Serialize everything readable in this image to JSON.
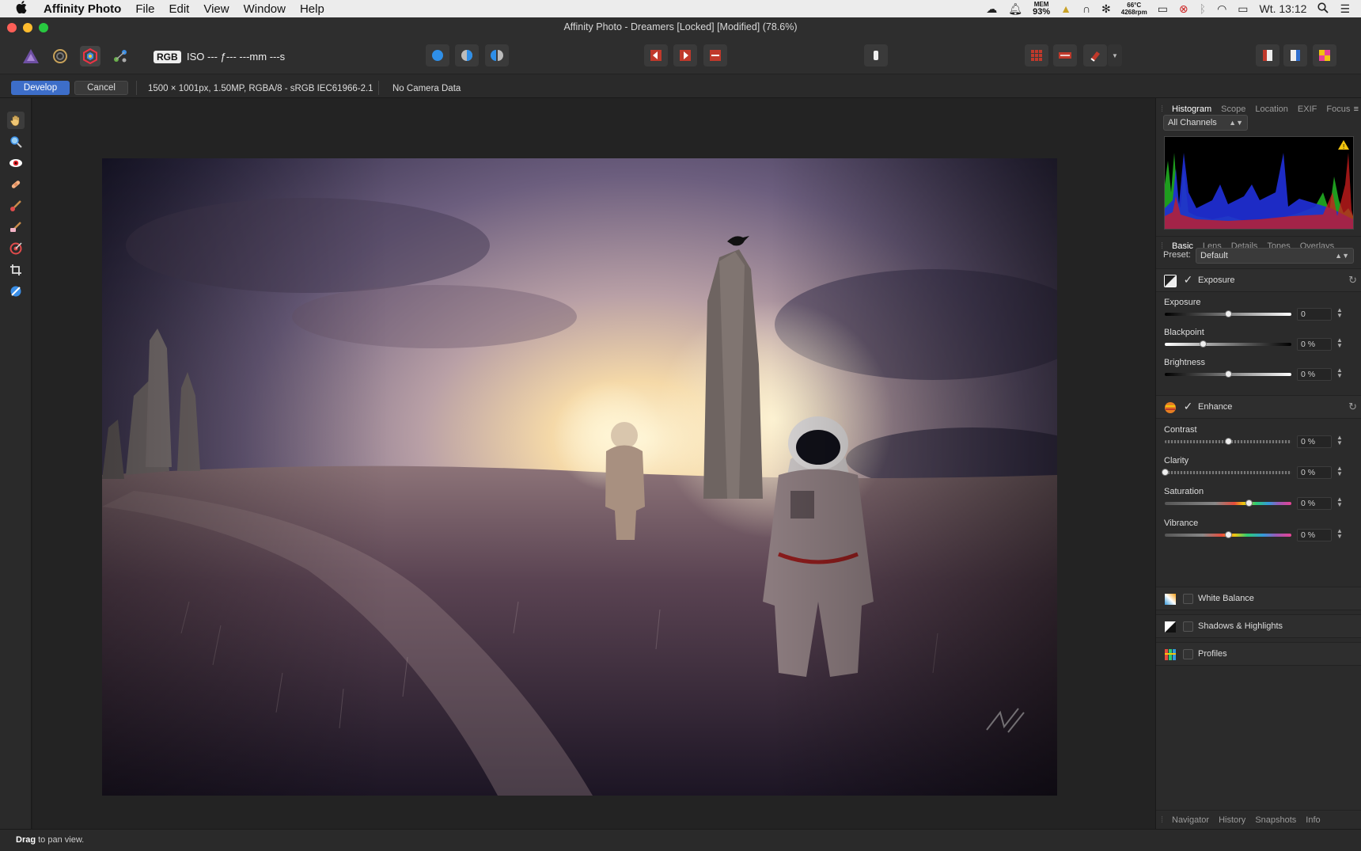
{
  "menubar": {
    "apple": "",
    "app_name": "Affinity Photo",
    "items": [
      "File",
      "Edit",
      "View",
      "Window",
      "Help"
    ],
    "mem_label": "MEM",
    "mem_value": "93%",
    "temp": "66°C",
    "fan": "4268rpm",
    "clock": "Wt. 13:12"
  },
  "window": {
    "title": "Affinity Photo - Dreamers [Locked] [Modified] (78.6%)"
  },
  "toolbar": {
    "rgb_badge": "RGB",
    "camera_info": "ISO --- ƒ--- ---mm ---s"
  },
  "context": {
    "develop_label": "Develop",
    "cancel_label": "Cancel",
    "doc_info": "1500 × 1001px, 1.50MP, RGBA/8 - sRGB IEC61966-2.1",
    "camera_data": "No Camera Data"
  },
  "panel": {
    "top_tabs": [
      "Histogram",
      "Scope",
      "Location",
      "EXIF",
      "Focus"
    ],
    "channels": "All Channels",
    "dev_tabs": [
      "Basic",
      "Lens",
      "Details",
      "Tones",
      "Overlays"
    ],
    "preset_label": "Preset:",
    "preset_value": "Default",
    "exposure_section": "Exposure",
    "exposure_label": "Exposure",
    "exposure_value": "0",
    "exposure_level": 0.5,
    "blackpoint_label": "Blackpoint",
    "blackpoint_value": "0 %",
    "blackpoint_level": 0.3,
    "brightness_label": "Brightness",
    "brightness_value": "0 %",
    "brightness_level": 0.5,
    "enhance_section": "Enhance",
    "contrast_label": "Contrast",
    "contrast_value": "0 %",
    "contrast_level": 0.5,
    "clarity_label": "Clarity",
    "clarity_value": "0 %",
    "clarity_level": 0.0,
    "saturation_label": "Saturation",
    "saturation_value": "0 %",
    "saturation_level": 0.66,
    "vibrance_label": "Vibrance",
    "vibrance_value": "0 %",
    "vibrance_level": 0.5,
    "white_balance": "White Balance",
    "shadows_highlights": "Shadows & Highlights",
    "profiles": "Profiles",
    "bottom_tabs": [
      "Navigator",
      "History",
      "Snapshots",
      "Info"
    ]
  },
  "status": {
    "bold": "Drag",
    "text": " to pan view."
  },
  "colors": {
    "accent": "#3d6ec9",
    "panel_bg": "#2b2b2b",
    "canvas_bg": "#232323"
  }
}
